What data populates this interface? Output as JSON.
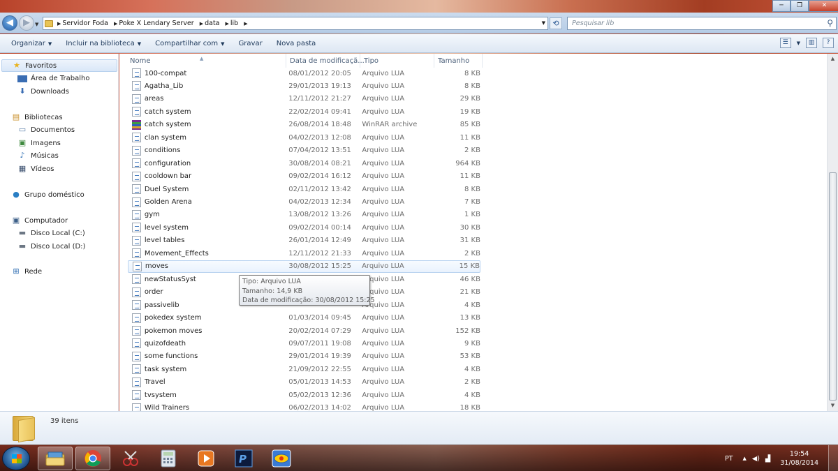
{
  "window": {
    "buttons": {
      "minimize": "─",
      "maximize": "❐",
      "close": "✕"
    }
  },
  "address": {
    "breadcrumbs": [
      "Servidor Foda",
      "Poke X Lendary Server",
      "data",
      "lib"
    ],
    "search_placeholder": "Pesquisar lib"
  },
  "toolbar": {
    "organize": "Organizar",
    "include_library": "Incluir na biblioteca",
    "share_with": "Compartilhar com",
    "burn": "Gravar",
    "new_folder": "Nova pasta"
  },
  "sidebar": {
    "favorites": "Favoritos",
    "desktop": "Área de Trabalho",
    "downloads": "Downloads",
    "libraries": "Bibliotecas",
    "documents": "Documentos",
    "images": "Imagens",
    "music": "Músicas",
    "videos": "Vídeos",
    "homegroup": "Grupo doméstico",
    "computer": "Computador",
    "disk_c": "Disco Local (C:)",
    "disk_d": "Disco Local (D:)",
    "network": "Rede"
  },
  "columns": {
    "name": "Nome",
    "date": "Data de modificaçã...",
    "type": "Tipo",
    "size": "Tamanho"
  },
  "files": [
    {
      "name": "100-compat",
      "date": "08/01/2012 20:05",
      "type": "Arquivo LUA",
      "size": "8 KB",
      "icon": "lua-file-icon"
    },
    {
      "name": "Agatha_Lib",
      "date": "29/01/2013 19:13",
      "type": "Arquivo LUA",
      "size": "8 KB",
      "icon": "lua-file-icon"
    },
    {
      "name": "areas",
      "date": "12/11/2012 21:27",
      "type": "Arquivo LUA",
      "size": "29 KB",
      "icon": "lua-file-icon"
    },
    {
      "name": "catch system",
      "date": "22/02/2014 09:41",
      "type": "Arquivo LUA",
      "size": "19 KB",
      "icon": "lua-file-icon"
    },
    {
      "name": "catch system",
      "date": "26/08/2014 18:48",
      "type": "WinRAR archive",
      "size": "85 KB",
      "icon": "winrar-archive-icon"
    },
    {
      "name": "clan system",
      "date": "04/02/2013 12:08",
      "type": "Arquivo LUA",
      "size": "11 KB",
      "icon": "lua-file-icon"
    },
    {
      "name": "conditions",
      "date": "07/04/2012 13:51",
      "type": "Arquivo LUA",
      "size": "2 KB",
      "icon": "lua-file-icon"
    },
    {
      "name": "configuration",
      "date": "30/08/2014 08:21",
      "type": "Arquivo LUA",
      "size": "964 KB",
      "icon": "lua-file-icon"
    },
    {
      "name": "cooldown bar",
      "date": "09/02/2014 16:12",
      "type": "Arquivo LUA",
      "size": "11 KB",
      "icon": "lua-file-icon"
    },
    {
      "name": "Duel System",
      "date": "02/11/2012 13:42",
      "type": "Arquivo LUA",
      "size": "8 KB",
      "icon": "lua-file-icon"
    },
    {
      "name": "Golden Arena",
      "date": "04/02/2013 12:34",
      "type": "Arquivo LUA",
      "size": "7 KB",
      "icon": "lua-file-icon"
    },
    {
      "name": "gym",
      "date": "13/08/2012 13:26",
      "type": "Arquivo LUA",
      "size": "1 KB",
      "icon": "lua-file-icon"
    },
    {
      "name": "level system",
      "date": "09/02/2014 00:14",
      "type": "Arquivo LUA",
      "size": "30 KB",
      "icon": "lua-file-icon"
    },
    {
      "name": "level tables",
      "date": "26/01/2014 12:49",
      "type": "Arquivo LUA",
      "size": "31 KB",
      "icon": "lua-file-icon"
    },
    {
      "name": "Movement_Effects",
      "date": "12/11/2012 21:33",
      "type": "Arquivo LUA",
      "size": "2 KB",
      "icon": "lua-file-icon"
    },
    {
      "name": "moves",
      "date": "30/08/2012 15:25",
      "type": "Arquivo LUA",
      "size": "15 KB",
      "icon": "lua-file-icon",
      "hover": true
    },
    {
      "name": "newStatusSyst",
      "date": "",
      "type": "Arquivo LUA",
      "size": "46 KB",
      "icon": "lua-file-icon"
    },
    {
      "name": "order",
      "date": "",
      "type": "Arquivo LUA",
      "size": "21 KB",
      "icon": "lua-file-icon"
    },
    {
      "name": "passivelib",
      "date": "",
      "type": "Arquivo LUA",
      "size": "4 KB",
      "icon": "lua-file-icon"
    },
    {
      "name": "pokedex system",
      "date": "01/03/2014 09:45",
      "type": "Arquivo LUA",
      "size": "13 KB",
      "icon": "lua-file-icon"
    },
    {
      "name": "pokemon moves",
      "date": "20/02/2014 07:29",
      "type": "Arquivo LUA",
      "size": "152 KB",
      "icon": "lua-file-icon"
    },
    {
      "name": "quizofdeath",
      "date": "09/07/2011 19:08",
      "type": "Arquivo LUA",
      "size": "9 KB",
      "icon": "lua-file-icon"
    },
    {
      "name": "some functions",
      "date": "29/01/2014 19:39",
      "type": "Arquivo LUA",
      "size": "53 KB",
      "icon": "lua-file-icon"
    },
    {
      "name": "task system",
      "date": "21/09/2012 22:55",
      "type": "Arquivo LUA",
      "size": "4 KB",
      "icon": "lua-file-icon"
    },
    {
      "name": "Travel",
      "date": "05/01/2013 14:53",
      "type": "Arquivo LUA",
      "size": "2 KB",
      "icon": "lua-file-icon"
    },
    {
      "name": "tvsystem",
      "date": "05/02/2013 12:36",
      "type": "Arquivo LUA",
      "size": "4 KB",
      "icon": "lua-file-icon"
    },
    {
      "name": "Wild Trainers",
      "date": "06/02/2013 14:02",
      "type": "Arquivo LUA",
      "size": "18 KB",
      "icon": "lua-file-icon"
    }
  ],
  "tooltip": {
    "line1": "Tipo: Arquivo LUA",
    "line2": "Tamanho: 14,9 KB",
    "line3": "Data de modificação: 30/08/2012 15:25"
  },
  "status": {
    "count": "39 itens"
  },
  "taskbar": {
    "apps": [
      "windows-explorer",
      "google-chrome",
      "snipping-tool",
      "calculator",
      "media-player",
      "pascal-ide",
      "pokemon-game"
    ],
    "language": "PT",
    "time": "19:54",
    "date": "31/08/2014"
  }
}
